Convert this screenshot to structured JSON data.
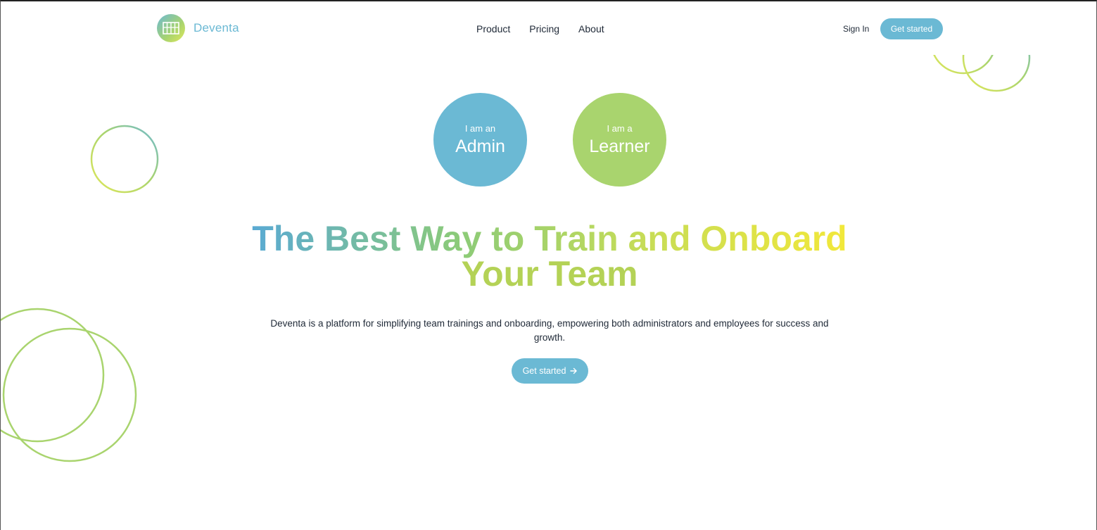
{
  "brand": {
    "name": "Deventa"
  },
  "nav": {
    "items": [
      "Product",
      "Pricing",
      "About"
    ]
  },
  "header": {
    "sign_in": "Sign In",
    "cta": "Get started"
  },
  "roles": {
    "admin": {
      "small": "I am an",
      "big": "Admin"
    },
    "learner": {
      "small": "I am a",
      "big": "Learner"
    }
  },
  "hero": {
    "title_line1": "The Best Way to Train and Onboard",
    "title_line2": "Your Team",
    "subtitle": "Deventa is a platform for simplifying team trainings and onboarding, empowering both administrators and employees for success and growth.",
    "cta": "Get started",
    "cta_icon": "arrow-right-icon"
  },
  "colors": {
    "blue": "#6bb9d4",
    "green": "#a9d46e",
    "yellow": "#f2e83a"
  }
}
